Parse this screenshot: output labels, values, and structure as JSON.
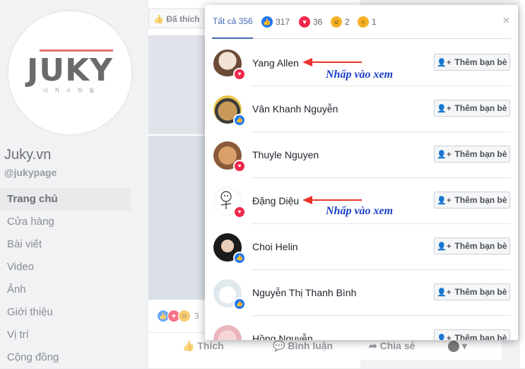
{
  "background": {
    "like_button": "Đã thích",
    "page_name": "Juky.vn",
    "page_handle": "@jukypage",
    "logo_text": "JUKY",
    "logo_sub": "너 키 스 타 일",
    "nav": [
      "Trang chủ",
      "Cửa hàng",
      "Bài viết",
      "Video",
      "Ảnh",
      "Giới thiệu",
      "Vị trí",
      "Cộng đồng"
    ],
    "reaction_count": "3",
    "actions": {
      "like": "Thích",
      "comment": "Bình luận",
      "share": "Chia sẻ"
    }
  },
  "dialog": {
    "tabs": [
      {
        "label": "Tất cả 356",
        "icon": ""
      },
      {
        "label": "317",
        "icon": "like-icon"
      },
      {
        "label": "36",
        "icon": "love-icon"
      },
      {
        "label": "2",
        "icon": "haha-icon"
      },
      {
        "label": "1",
        "icon": "wow-icon"
      }
    ],
    "close": "×",
    "add_friend_label": "Thêm bạn bè",
    "people": [
      {
        "name": "Yang Allen",
        "reaction": "love"
      },
      {
        "name": "Vân Khanh Nguyễn",
        "reaction": "like"
      },
      {
        "name": "Thuyle Nguyen",
        "reaction": "love"
      },
      {
        "name": "Đặng Diệu",
        "reaction": "love"
      },
      {
        "name": "Choi Helin",
        "reaction": "like"
      },
      {
        "name": "Nguyễn Thị Thanh Bình",
        "reaction": "like"
      },
      {
        "name": "Hồng Nguyễn",
        "reaction": ""
      }
    ],
    "annotation": "Nhấp vào xem"
  },
  "colors": {
    "fb_blue": "#4267b2",
    "love_red": "#f0284a",
    "like_blue": "#2078f4",
    "annotation_blue": "#1a3fc7",
    "arrow_red": "#e8332b"
  }
}
